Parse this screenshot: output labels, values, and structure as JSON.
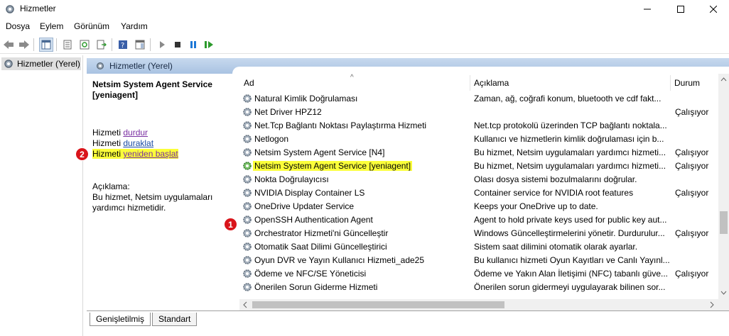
{
  "window": {
    "title": "Hizmetler"
  },
  "menu": [
    "Dosya",
    "Eylem",
    "Görünüm",
    "Yardım"
  ],
  "tree": {
    "root": "Hizmetler (Yerel)"
  },
  "panel": {
    "header": "Hizmetler (Yerel)"
  },
  "details": {
    "service_name": "Netsim System Agent Service [yeniagent]",
    "stop_prefix": "Hizmeti ",
    "stop_link": "durdur",
    "pause_prefix": "Hizmeti ",
    "pause_link": "duraklat",
    "restart_prefix": "Hizmeti ",
    "restart_link": "yeniden başlat",
    "description_label": "Açıklama:",
    "description_text": "Bu hizmet, Netsim uygulamaları yardımcı hizmetidir."
  },
  "badges": {
    "first": "1",
    "second": "2"
  },
  "columns": {
    "name": "Ad",
    "description": "Açıklama",
    "status": "Durum",
    "sort_glyph": "^"
  },
  "services": [
    {
      "name": "Natural Kimlik Doğrulaması",
      "description": "Zaman, ağ, coğrafi konum, bluetooth ve cdf fakt...",
      "status": ""
    },
    {
      "name": "Net Driver HPZ12",
      "description": "",
      "status": "Çalışıyor"
    },
    {
      "name": "Net.Tcp Bağlantı Noktası Paylaştırma Hizmeti",
      "description": "Net.tcp protokolü üzerinden TCP bağlantı noktala...",
      "status": ""
    },
    {
      "name": "Netlogon",
      "description": "Kullanıcı ve hizmetlerin kimlik doğrulaması için b...",
      "status": ""
    },
    {
      "name": "Netsim System Agent Service [N4]",
      "description": "Bu hizmet, Netsim uygulamaları yardımcı hizmeti...",
      "status": "Çalışıyor"
    },
    {
      "name": "Netsim System Agent Service [yeniagent]",
      "description": "Bu hizmet, Netsim uygulamaları yardımcı hizmeti...",
      "status": "Çalışıyor"
    },
    {
      "name": "Nokta Doğrulayıcısı",
      "description": "Olası dosya sistemi bozulmalarını doğrular.",
      "status": ""
    },
    {
      "name": "NVIDIA Display Container LS",
      "description": "Container service for NVIDIA root features",
      "status": "Çalışıyor"
    },
    {
      "name": "OneDrive Updater Service",
      "description": "Keeps your OneDrive up to date.",
      "status": ""
    },
    {
      "name": "OpenSSH Authentication Agent",
      "description": "Agent to hold private keys used for public key aut...",
      "status": ""
    },
    {
      "name": "Orchestrator Hizmeti'ni Güncelleştir",
      "description": "Windows Güncelleştirmelerini yönetir. Durdurulur...",
      "status": "Çalışıyor"
    },
    {
      "name": "Otomatik Saat Dilimi Güncelleştirici",
      "description": "Sistem saat dilimini otomatik olarak ayarlar.",
      "status": ""
    },
    {
      "name": "Oyun DVR ve Yayın Kullanıcı Hizmeti_ade25",
      "description": "Bu kullanıcı hizmeti Oyun Kayıtları ve Canlı Yayınl...",
      "status": ""
    },
    {
      "name": "Ödeme ve NFC/SE Yöneticisi",
      "description": "Ödeme ve Yakın Alan İletişimi (NFC) tabanlı güve...",
      "status": "Çalışıyor"
    },
    {
      "name": "Önerilen Sorun Giderme Hizmeti",
      "description": "Önerilen sorun gidermeyi uygulayarak bilinen sor...",
      "status": ""
    }
  ],
  "tabs": [
    "Genişletilmiş",
    "Standart"
  ],
  "colors": {
    "highlight": "#fbff3a",
    "badge": "#d9141a",
    "selection": "#cce8ff",
    "header": "#b6cde8"
  }
}
